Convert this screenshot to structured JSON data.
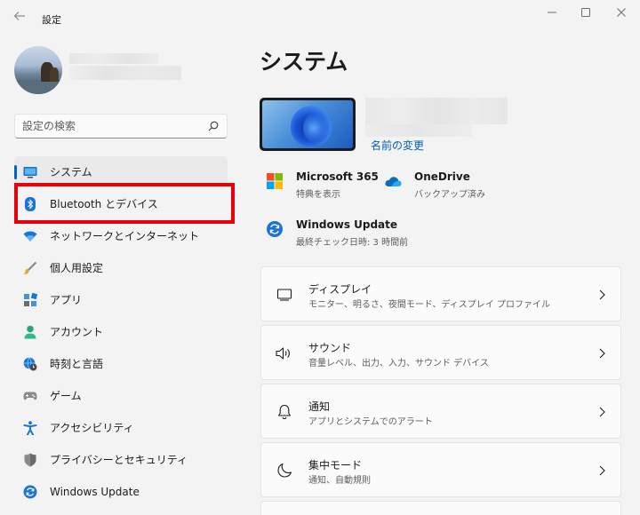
{
  "window": {
    "title": "設定",
    "back_icon": "back-arrow-icon",
    "controls": [
      "minimize",
      "maximize",
      "close"
    ]
  },
  "search": {
    "placeholder": "設定の検索"
  },
  "sidebar": {
    "items": [
      {
        "label": "システム",
        "icon": "monitor-icon",
        "selected": true
      },
      {
        "label": "Bluetooth とデバイス",
        "icon": "bluetooth-icon",
        "selected": false,
        "highlighted": true
      },
      {
        "label": "ネットワークとインターネット",
        "icon": "wifi-icon",
        "selected": false
      },
      {
        "label": "個人用設定",
        "icon": "brush-icon",
        "selected": false
      },
      {
        "label": "アプリ",
        "icon": "apps-icon",
        "selected": false
      },
      {
        "label": "アカウント",
        "icon": "person-icon",
        "selected": false
      },
      {
        "label": "時刻と言語",
        "icon": "globe-clock-icon",
        "selected": false
      },
      {
        "label": "ゲーム",
        "icon": "gamepad-icon",
        "selected": false
      },
      {
        "label": "アクセシビリティ",
        "icon": "accessibility-icon",
        "selected": false
      },
      {
        "label": "プライバシーとセキュリティ",
        "icon": "shield-icon",
        "selected": false
      },
      {
        "label": "Windows Update",
        "icon": "update-icon",
        "selected": false
      }
    ]
  },
  "main": {
    "title": "システム",
    "rename_link": "名前の変更",
    "tiles": [
      {
        "title": "Microsoft 365",
        "subtitle": "特典を表示",
        "icon": "microsoft-logo-icon"
      },
      {
        "title": "OneDrive",
        "subtitle": "バックアップ済み",
        "icon": "cloud-icon"
      },
      {
        "title": "Windows Update",
        "subtitle": "最終チェック日時: 3 時間前",
        "icon": "update-icon"
      }
    ],
    "cards": [
      {
        "title": "ディスプレイ",
        "subtitle": "モニター、明るさ、夜間モード、ディスプレイ プロファイル",
        "icon": "display-icon"
      },
      {
        "title": "サウンド",
        "subtitle": "音量レベル、出力、入力、サウンド デバイス",
        "icon": "speaker-icon"
      },
      {
        "title": "通知",
        "subtitle": "アプリとシステムでのアラート",
        "icon": "bell-icon"
      },
      {
        "title": "集中モード",
        "subtitle": "通知、自動規則",
        "icon": "moon-icon"
      }
    ]
  },
  "colors": {
    "accent": "#0067c0",
    "link": "#005fb8",
    "highlight_box": "#e8000b",
    "background": "#f3f3f3"
  }
}
